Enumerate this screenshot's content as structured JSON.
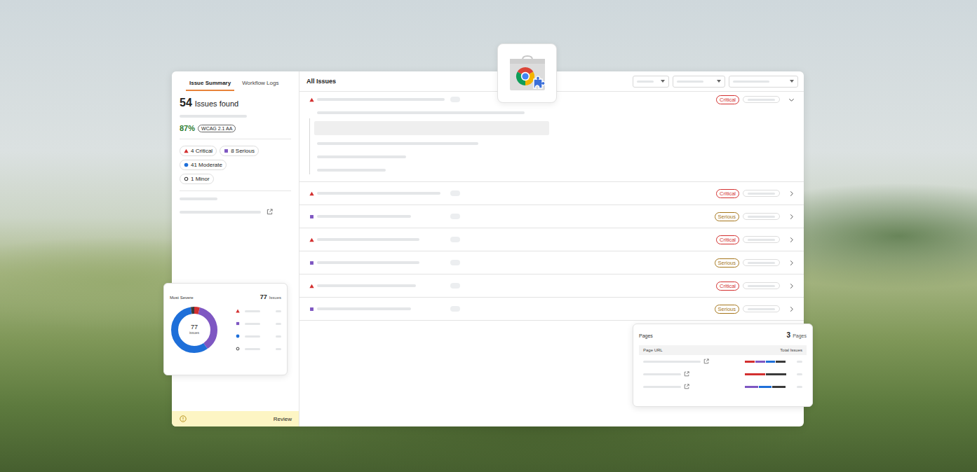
{
  "sidebar": {
    "tabs": [
      {
        "label": "Issue Summary",
        "selected": true
      },
      {
        "label": "Workflow Logs",
        "selected": false
      }
    ],
    "issue_count": "54",
    "issue_label": "Issues found",
    "score": "87%",
    "standard": "WCAG 2.1 AA",
    "chips": [
      {
        "label": "4 Critical",
        "kind": "critical",
        "color": "#d32f2f"
      },
      {
        "label": "8 Serious",
        "kind": "serious",
        "color": "#7e57c2"
      },
      {
        "label": "41 Moderate",
        "kind": "moderate",
        "color": "#1e6fd9"
      },
      {
        "label": "1 Minor",
        "kind": "minor",
        "color": "#3a3a3a"
      }
    ],
    "review": {
      "label": "Review"
    }
  },
  "main": {
    "title": "All Issues",
    "rows": [
      {
        "badge": "Critical",
        "kind": "critical",
        "color": "#d32f2f",
        "badge_color": "#d32f2f",
        "expanded": true
      },
      {
        "badge": "Critical",
        "kind": "critical",
        "color": "#d32f2f",
        "badge_color": "#d32f2f",
        "expanded": false
      },
      {
        "badge": "Serious",
        "kind": "serious",
        "color": "#7e57c2",
        "badge_color": "#a5761b",
        "expanded": false
      },
      {
        "badge": "Critical",
        "kind": "critical",
        "color": "#d32f2f",
        "badge_color": "#d32f2f",
        "expanded": false
      },
      {
        "badge": "Serious",
        "kind": "serious",
        "color": "#7e57c2",
        "badge_color": "#a5761b",
        "expanded": false
      },
      {
        "badge": "Critical",
        "kind": "critical",
        "color": "#d32f2f",
        "badge_color": "#d32f2f",
        "expanded": false
      },
      {
        "badge": "Serious",
        "kind": "serious",
        "color": "#7e57c2",
        "badge_color": "#a5761b",
        "expanded": false
      }
    ]
  },
  "severity_chart": {
    "title": "Most Severe",
    "count": "77",
    "count_label": "Issues",
    "center_value": "77",
    "center_label": "issues",
    "slices": [
      {
        "kind": "critical",
        "value": 3,
        "color": "#d32f2f"
      },
      {
        "kind": "serious",
        "value": 28,
        "color": "#7e57c2"
      },
      {
        "kind": "moderate",
        "value": 44,
        "color": "#1e6fd9"
      },
      {
        "kind": "minor",
        "value": 2,
        "color": "#3a3a3a"
      }
    ]
  },
  "pages_card": {
    "title": "Pages",
    "count": "3",
    "count_label": "Pages",
    "columns": [
      "Page URL",
      "Total Issues"
    ],
    "rows": [
      {
        "segments": [
          {
            "level": 0.23,
            "color": "#d32f2f"
          },
          {
            "level": 0.23,
            "color": "#7e57c2"
          },
          {
            "level": 0.23,
            "color": "#1e6fd9"
          },
          {
            "level": 0.23,
            "color": "#3a3a3a"
          }
        ]
      },
      {
        "segments": [
          {
            "level": 0.48,
            "color": "#d32f2f"
          },
          {
            "level": 0.48,
            "color": "#3a3a3a"
          }
        ]
      },
      {
        "segments": [
          {
            "level": 0.31,
            "color": "#7e57c2"
          },
          {
            "level": 0.31,
            "color": "#1e6fd9"
          },
          {
            "level": 0.31,
            "color": "#3a3a3a"
          }
        ]
      }
    ]
  }
}
